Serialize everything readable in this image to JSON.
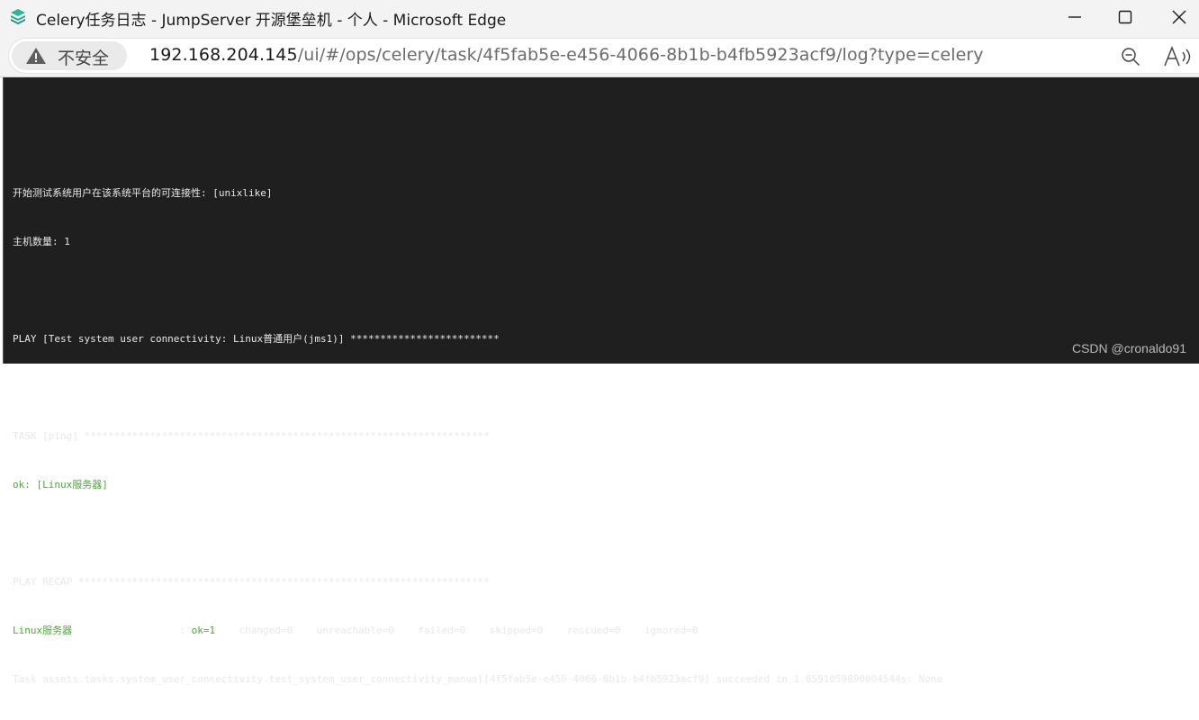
{
  "window": {
    "title": "Celery任务日志 - JumpServer 开源堡垒机 - 个人 - Microsoft Edge",
    "app_icon": "jumpserver-logo-icon",
    "controls": [
      "minimize-icon",
      "maximize-icon",
      "close-icon"
    ]
  },
  "address_bar": {
    "security_label": "不安全",
    "security_icon": "warning-triangle-icon",
    "url_host": "192.168.204.145",
    "url_path": "/ui/#/ops/celery/task/4f5fab5e-e456-4066-8b1b-b4fb5923acf9/log?type=celery",
    "right_icons": [
      "zoom-out-icon",
      "read-aloud-icon"
    ]
  },
  "log": {
    "lines": [
      {
        "text": "",
        "style": "normal"
      },
      {
        "text": "开始测试系统用户在该系统平台的可连接性: [unixlike]",
        "style": "normal"
      },
      {
        "text": "主机数量: 1",
        "style": "normal"
      },
      {
        "text": "",
        "style": "normal"
      },
      {
        "text": "PLAY [Test system user connectivity: Linux普通用户(jms1)] *************************",
        "style": "normal"
      },
      {
        "text": "",
        "style": "normal"
      },
      {
        "text": "TASK [ping] ********************************************************************",
        "style": "normal"
      },
      {
        "text": "ok: [Linux服务器]",
        "style": "green"
      },
      {
        "text": "",
        "style": "normal"
      },
      {
        "text": "PLAY RECAP *********************************************************************",
        "style": "normal"
      }
    ],
    "recap": {
      "host": "Linux服务器",
      "sep": "                  : ",
      "ok": "ok=1",
      "rest": "    changed=0    unreachable=0    failed=0    skipped=0    rescued=0    ignored=0"
    },
    "final_line": "Task assets.tasks.system_user_connectivity.test_system_user_connectivity_manual[4f5fab5e-e456-4066-8b1b-b4fb5923acf9] succeeded in 1.8591059890004544s: None"
  },
  "watermark": "CSDN @cronaldo91",
  "colors": {
    "terminal_bg": "#1f1f1f",
    "terminal_text": "#e8e8e8",
    "ok_green": "#4ea83a"
  }
}
